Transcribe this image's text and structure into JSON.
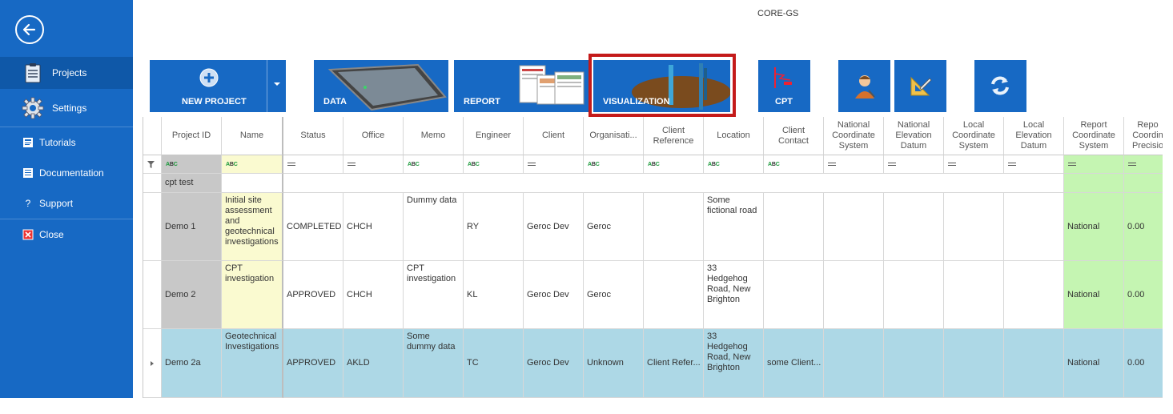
{
  "window": {
    "title": "CORE-GS"
  },
  "sidebar": {
    "items": [
      {
        "label": "Projects",
        "icon": "clipboard-icon"
      },
      {
        "label": "Settings",
        "icon": "gear-icon"
      },
      {
        "label": "Tutorials",
        "icon": "tutorials-icon"
      },
      {
        "label": "Documentation",
        "icon": "documentation-icon"
      },
      {
        "label": "Support",
        "icon": "question-icon"
      },
      {
        "label": "Close",
        "icon": "close-icon"
      }
    ]
  },
  "toolbar": {
    "new_project": "NEW PROJECT",
    "data": "DATA",
    "report": "REPORT",
    "visualization": "VISUALIZATION",
    "cpt": "CPT"
  },
  "grid": {
    "columns": [
      "Project ID",
      "Name",
      "Status",
      "Office",
      "Memo",
      "Engineer",
      "Client",
      "Organisati...",
      "Client Reference",
      "Location",
      "Client Contact",
      "National Coordinate System",
      "National Elevation Datum",
      "Local Coordinate System",
      "Local Elevation Datum",
      "Report Coordinate System",
      "Repo Coordin Precisio"
    ],
    "group": "cpt test",
    "rows": [
      {
        "project_id": "Demo 1",
        "name": "Initial site assessment and geotechnical investigations",
        "status": "COMPLETED",
        "office": "CHCH",
        "memo": "Dummy data",
        "engineer": "RY",
        "client": "Geroc Dev",
        "organisation": "Geroc",
        "client_reference": "",
        "location": "Some fictional road",
        "client_contact": "",
        "report_coordinate_system": "National",
        "precision": "0.00"
      },
      {
        "project_id": "Demo 2",
        "name": "CPT investigation",
        "status": "APPROVED",
        "office": "CHCH",
        "memo": "CPT investigation",
        "engineer": "KL",
        "client": "Geroc Dev",
        "organisation": "Geroc",
        "client_reference": "",
        "location": "33 Hedgehog Road, New Brighton",
        "client_contact": "",
        "report_coordinate_system": "National",
        "precision": "0.00"
      },
      {
        "project_id": "Demo 2a",
        "name": "Geotechnical Investigations",
        "status": "APPROVED",
        "office": "AKLD",
        "memo": "Some dummy data",
        "engineer": "TC",
        "client": "Geroc Dev",
        "organisation": "Unknown",
        "client_reference": "Client Refer...",
        "location": "33 Hedgehog Road, New Brighton",
        "client_contact": "some Client...",
        "report_coordinate_system": "National",
        "precision": "0.00"
      }
    ]
  },
  "colors": {
    "sidebar": "#1769c4",
    "selected_row": "#add8e6",
    "highlight": "#c41a1a",
    "report_columns": "#c5f5b2"
  }
}
